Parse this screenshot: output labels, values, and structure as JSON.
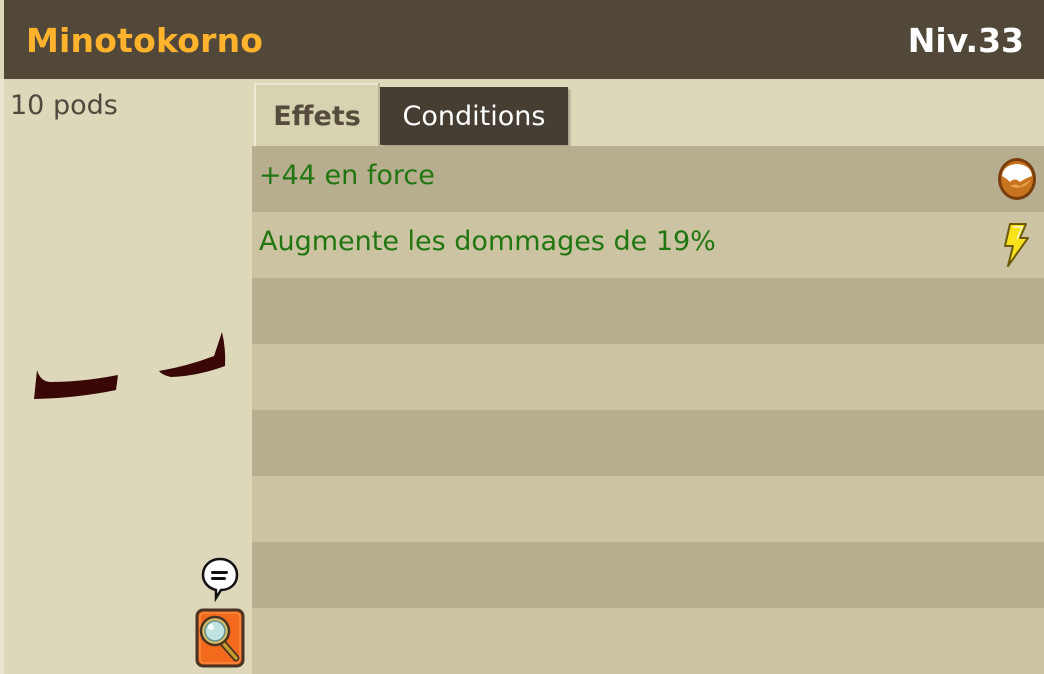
{
  "header": {
    "item_name": "Minotokorno",
    "item_level": "Niv.33"
  },
  "item": {
    "weight": "10 pods"
  },
  "tabs": [
    {
      "label": "Effets",
      "active": true
    },
    {
      "label": "Conditions",
      "active": false
    }
  ],
  "effects": [
    {
      "text": "+44 en force",
      "icon": "earth-element-icon"
    },
    {
      "text": "Augmente les dommages de 19%",
      "icon": "lightning-icon"
    }
  ],
  "colors": {
    "header_bg": "#51483a",
    "item_name": "#ffb22c",
    "effect_text": "#227611",
    "row_dark": "#b6ae8f",
    "row_light": "#cbc3a1",
    "search_button": "#f26a1b"
  }
}
